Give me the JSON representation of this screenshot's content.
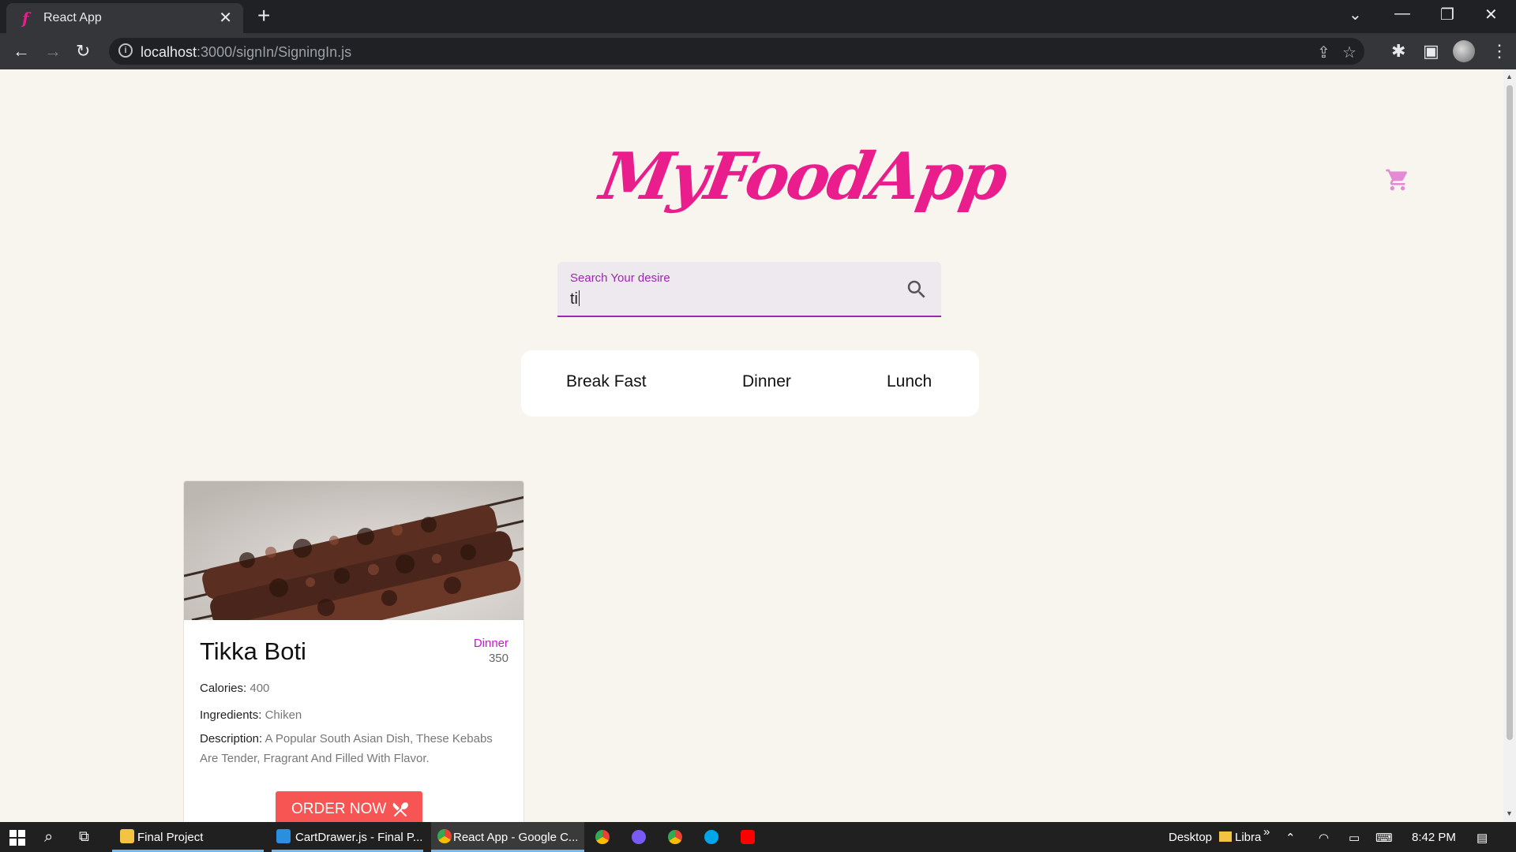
{
  "browser": {
    "tab_title": "React App",
    "url_host": "localhost",
    "url_path": ":3000/signIn/SigningIn.js"
  },
  "app": {
    "logo_text": "MyFoodApp",
    "accent_color": "#e91e8c",
    "search": {
      "label": "Search Your desire",
      "value": "ti"
    },
    "categories": [
      "Break Fast",
      "Dinner",
      "Lunch"
    ],
    "card": {
      "title": "Tikka Boti",
      "category": "Dinner",
      "price": "350",
      "calories_label": "Calories:",
      "calories_value": "400",
      "ingredients_label": "Ingredients:",
      "ingredients_value": "Chiken",
      "description_label": "Description:",
      "description_value": "A Popular South Asian Dish, These Kebabs Are Tender, Fragrant And Filled With Flavor.",
      "button_label": "ORDER NOW"
    }
  },
  "taskbar": {
    "items": [
      {
        "label": "Final Project",
        "icon": "file-explorer-icon"
      },
      {
        "label": "CartDrawer.js - Final P...",
        "icon": "vscode-icon"
      },
      {
        "label": "React App - Google C...",
        "icon": "chrome-icon"
      }
    ],
    "desktop_label": "Desktop",
    "library_label": "Libra",
    "time": "8:42 PM"
  }
}
